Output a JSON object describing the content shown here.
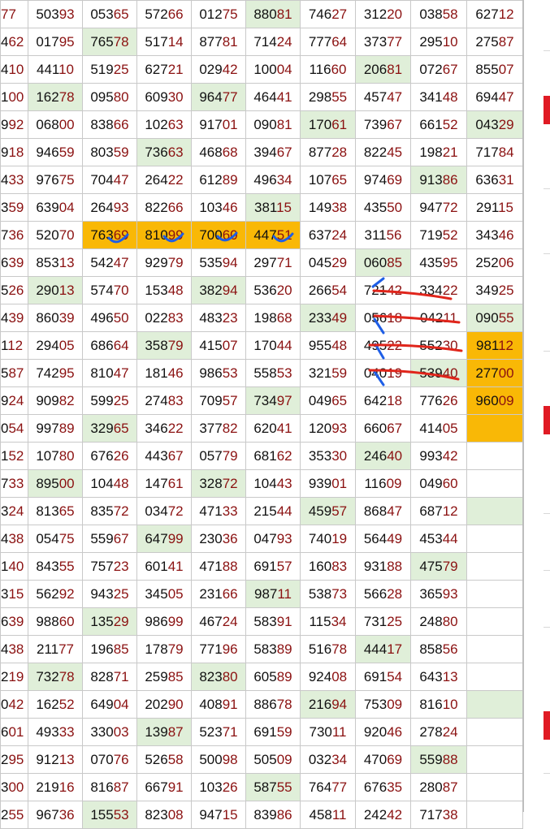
{
  "rows": [
    [
      "77",
      "50393",
      "05365",
      "57266",
      "01275",
      "88081",
      "74627",
      "31220",
      "03858",
      "62712"
    ],
    [
      "462",
      "01795",
      "76578",
      "51714",
      "87781",
      "71424",
      "77764",
      "37377",
      "29510",
      "27587"
    ],
    [
      "410",
      "44110",
      "51925",
      "62721",
      "02942",
      "10004",
      "11660",
      "20681",
      "07267",
      "85507"
    ],
    [
      "100",
      "16278",
      "09580",
      "60930",
      "96477",
      "46441",
      "29855",
      "45747",
      "34148",
      "69447"
    ],
    [
      "992",
      "06800",
      "83866",
      "10263",
      "91701",
      "09081",
      "17061",
      "73967",
      "66152",
      "04329"
    ],
    [
      "918",
      "94659",
      "80359",
      "73663",
      "46868",
      "39467",
      "87728",
      "82245",
      "19821",
      "71784"
    ],
    [
      "433",
      "97675",
      "70447",
      "26422",
      "61289",
      "49634",
      "10765",
      "97469",
      "91386",
      "63631"
    ],
    [
      "359",
      "63904",
      "26493",
      "82266",
      "10346",
      "38115",
      "14938",
      "43550",
      "94772",
      "29115"
    ],
    [
      "736",
      "52070",
      "76369",
      "81099",
      "70060",
      "44751",
      "63724",
      "31156",
      "71952",
      "34346"
    ],
    [
      "639",
      "85313",
      "54247",
      "92979",
      "53594",
      "29771",
      "04529",
      "06085",
      "43595",
      "25206"
    ],
    [
      "526",
      "29013",
      "57470",
      "15348",
      "38294",
      "53620",
      "26654",
      "72142",
      "33422",
      "34925"
    ],
    [
      "439",
      "86039",
      "49650",
      "02283",
      "48323",
      "19868",
      "23349",
      "05618",
      "04211",
      "09055"
    ],
    [
      "112",
      "29405",
      "68664",
      "35879",
      "41507",
      "17044",
      "95548",
      "49522",
      "55230",
      "98112"
    ],
    [
      "587",
      "74295",
      "81047",
      "18146",
      "98653",
      "55853",
      "32159",
      "04019",
      "53940",
      "27700"
    ],
    [
      "924",
      "90982",
      "59925",
      "27483",
      "70957",
      "73497",
      "04965",
      "64218",
      "77626",
      "96009"
    ],
    [
      "054",
      "99789",
      "32965",
      "34622",
      "37782",
      "62041",
      "12093",
      "66067",
      "41405",
      ""
    ],
    [
      "152",
      "10780",
      "67626",
      "44367",
      "05779",
      "68162",
      "35330",
      "24640",
      "99342",
      ""
    ],
    [
      "733",
      "89500",
      "10448",
      "14761",
      "32872",
      "10443",
      "93901",
      "11609",
      "04960",
      ""
    ],
    [
      "324",
      "81365",
      "83572",
      "03472",
      "47133",
      "21544",
      "45957",
      "86847",
      "68712",
      ""
    ],
    [
      "438",
      "05475",
      "55967",
      "64799",
      "23036",
      "04793",
      "74019",
      "56449",
      "45344",
      ""
    ],
    [
      "140",
      "84355",
      "75723",
      "60141",
      "47188",
      "69157",
      "16083",
      "93188",
      "47579",
      ""
    ],
    [
      "315",
      "56292",
      "94325",
      "34505",
      "23166",
      "98711",
      "53873",
      "56628",
      "36593",
      ""
    ],
    [
      "639",
      "98860",
      "13529",
      "98699",
      "46724",
      "58391",
      "11534",
      "73125",
      "24880",
      ""
    ],
    [
      "438",
      "21177",
      "19685",
      "17879",
      "77196",
      "58389",
      "51678",
      "44417",
      "85856",
      ""
    ],
    [
      "219",
      "73278",
      "82871",
      "25985",
      "82380",
      "60589",
      "92408",
      "69154",
      "64313",
      ""
    ],
    [
      "042",
      "16252",
      "64904",
      "20290",
      "40891",
      "88678",
      "21694",
      "75309",
      "81610",
      ""
    ],
    [
      "601",
      "49333",
      "33003",
      "13987",
      "52371",
      "69159",
      "73011",
      "92046",
      "27824",
      ""
    ],
    [
      "295",
      "91213",
      "07076",
      "52658",
      "50098",
      "50509",
      "03234",
      "47069",
      "55988",
      ""
    ],
    [
      "300",
      "21916",
      "81687",
      "66791",
      "10326",
      "58755",
      "76477",
      "67635",
      "28087",
      ""
    ],
    [
      "255",
      "96736",
      "15553",
      "82308",
      "94715",
      "83986",
      "45811",
      "24242",
      "71738",
      ""
    ]
  ],
  "green_cells": [
    [
      0,
      5
    ],
    [
      1,
      2
    ],
    [
      2,
      7
    ],
    [
      3,
      1
    ],
    [
      3,
      4
    ],
    [
      4,
      6
    ],
    [
      4,
      9
    ],
    [
      5,
      3
    ],
    [
      6,
      8
    ],
    [
      7,
      5
    ],
    [
      9,
      7
    ],
    [
      10,
      1
    ],
    [
      10,
      4
    ],
    [
      11,
      6
    ],
    [
      11,
      9
    ],
    [
      12,
      3
    ],
    [
      13,
      8
    ],
    [
      14,
      5
    ],
    [
      15,
      2
    ],
    [
      16,
      7
    ],
    [
      17,
      1
    ],
    [
      17,
      4
    ],
    [
      18,
      6
    ],
    [
      18,
      9
    ],
    [
      19,
      3
    ],
    [
      20,
      8
    ],
    [
      21,
      5
    ],
    [
      22,
      2
    ],
    [
      23,
      7
    ],
    [
      24,
      1
    ],
    [
      24,
      4
    ],
    [
      25,
      6
    ],
    [
      25,
      9
    ],
    [
      26,
      3
    ],
    [
      27,
      8
    ],
    [
      28,
      5
    ],
    [
      29,
      2
    ]
  ],
  "orange_cells": [
    [
      8,
      2
    ],
    [
      8,
      3
    ],
    [
      8,
      4
    ],
    [
      8,
      5
    ],
    [
      12,
      9
    ],
    [
      13,
      9
    ],
    [
      14,
      9
    ],
    [
      15,
      9
    ]
  ],
  "colors": {
    "green": "#e0efd9",
    "orange": "#f9b806",
    "dark_digits": "#111111",
    "red_digits": "#8b1111",
    "pen_red": "#e0251b",
    "pen_blue": "#1e5ee6",
    "grid_line": "#c9c9c9"
  }
}
